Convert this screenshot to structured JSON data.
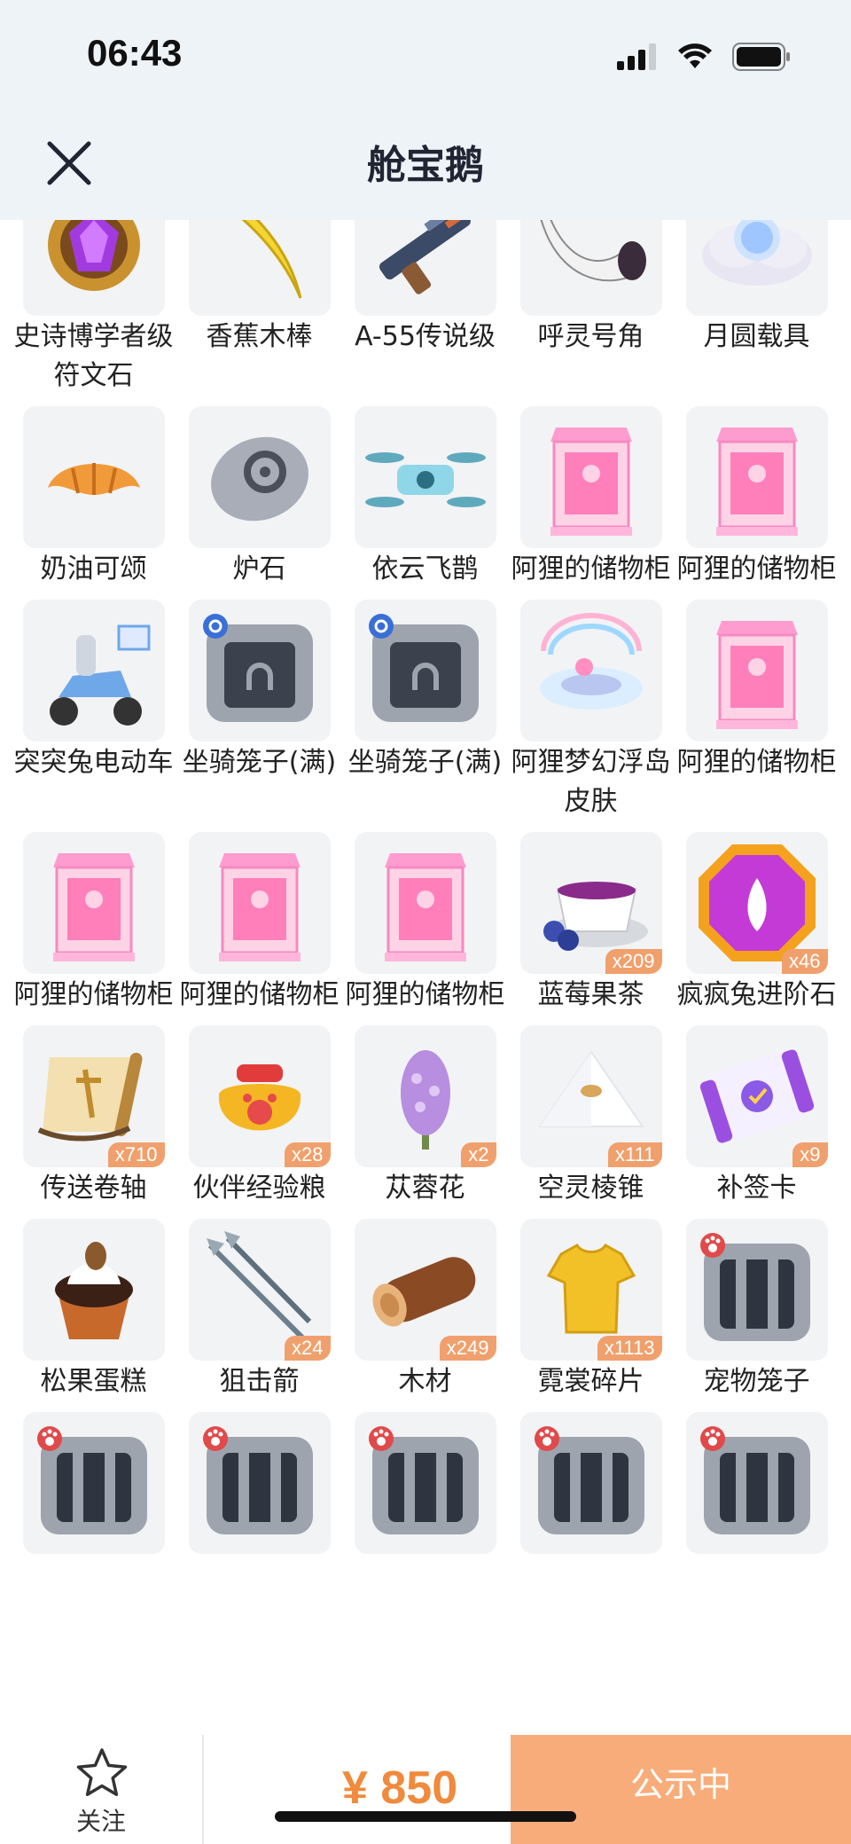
{
  "status_bar": {
    "time": "06:43"
  },
  "header": {
    "title": "舱宝鹅"
  },
  "items": [
    {
      "name": "史诗博学者级符文石",
      "badge": "",
      "icon": "purple-rune-stone"
    },
    {
      "name": "香蕉木棒",
      "badge": "",
      "icon": "banana-stick"
    },
    {
      "name": "A-55传说级",
      "badge": "",
      "icon": "blaster-gun"
    },
    {
      "name": "呼灵号角",
      "badge": "",
      "icon": "horn"
    },
    {
      "name": "月圆载具",
      "badge": "",
      "icon": "moon-cloud"
    },
    {
      "name": "奶油可颂",
      "badge": "",
      "icon": "croissant"
    },
    {
      "name": "炉石",
      "badge": "",
      "icon": "hearthstone"
    },
    {
      "name": "依云飞鹊",
      "badge": "",
      "icon": "drone"
    },
    {
      "name": "阿狸的储物柜",
      "badge": "",
      "icon": "pink-cabinet"
    },
    {
      "name": "阿狸的储物柜",
      "badge": "",
      "icon": "pink-cabinet"
    },
    {
      "name": "突突兔电动车",
      "badge": "",
      "icon": "scooter"
    },
    {
      "name": "坐骑笼子(满)",
      "badge": "",
      "icon": "mount-cage"
    },
    {
      "name": "坐骑笼子(满)",
      "badge": "",
      "icon": "mount-cage"
    },
    {
      "name": "阿狸梦幻浮岛皮肤",
      "badge": "",
      "icon": "floating-island"
    },
    {
      "name": "阿狸的储物柜",
      "badge": "",
      "icon": "pink-cabinet"
    },
    {
      "name": "阿狸的储物柜",
      "badge": "",
      "icon": "pink-cabinet"
    },
    {
      "name": "阿狸的储物柜",
      "badge": "",
      "icon": "pink-cabinet"
    },
    {
      "name": "阿狸的储物柜",
      "badge": "",
      "icon": "pink-cabinet"
    },
    {
      "name": "蓝莓果茶",
      "badge": "x209",
      "icon": "blueberry-tea"
    },
    {
      "name": "疯疯兔进阶石",
      "badge": "x46",
      "icon": "gem-octagon"
    },
    {
      "name": "传送卷轴",
      "badge": "x710",
      "icon": "scroll"
    },
    {
      "name": "伙伴经验粮",
      "badge": "x28",
      "icon": "food-bag"
    },
    {
      "name": "苁蓉花",
      "badge": "x2",
      "icon": "flower"
    },
    {
      "name": "空灵棱锥",
      "badge": "x111",
      "icon": "pyramid"
    },
    {
      "name": "补签卡",
      "badge": "x9",
      "icon": "ticket"
    },
    {
      "name": "松果蛋糕",
      "badge": "",
      "icon": "cupcake"
    },
    {
      "name": "狙击箭",
      "badge": "x24",
      "icon": "arrows"
    },
    {
      "name": "木材",
      "badge": "x249",
      "icon": "wood-log"
    },
    {
      "name": "霓裳碎片",
      "badge": "x1113",
      "icon": "shirt"
    },
    {
      "name": "宠物笼子",
      "badge": "",
      "icon": "pet-cage"
    },
    {
      "name": "",
      "badge": "",
      "icon": "pet-cage"
    },
    {
      "name": "",
      "badge": "",
      "icon": "pet-cage"
    },
    {
      "name": "",
      "badge": "",
      "icon": "pet-cage"
    },
    {
      "name": "",
      "badge": "",
      "icon": "pet-cage"
    },
    {
      "name": "",
      "badge": "",
      "icon": "pet-cage"
    }
  ],
  "bottom_bar": {
    "follow_label": "关注",
    "price": "¥ 850",
    "status_button": "公示中"
  },
  "colors": {
    "accent": "#f08a3c",
    "status_button_bg": "#f8ac79",
    "header_bg": "#eef3f7",
    "badge_bg": "#f0a06c"
  }
}
